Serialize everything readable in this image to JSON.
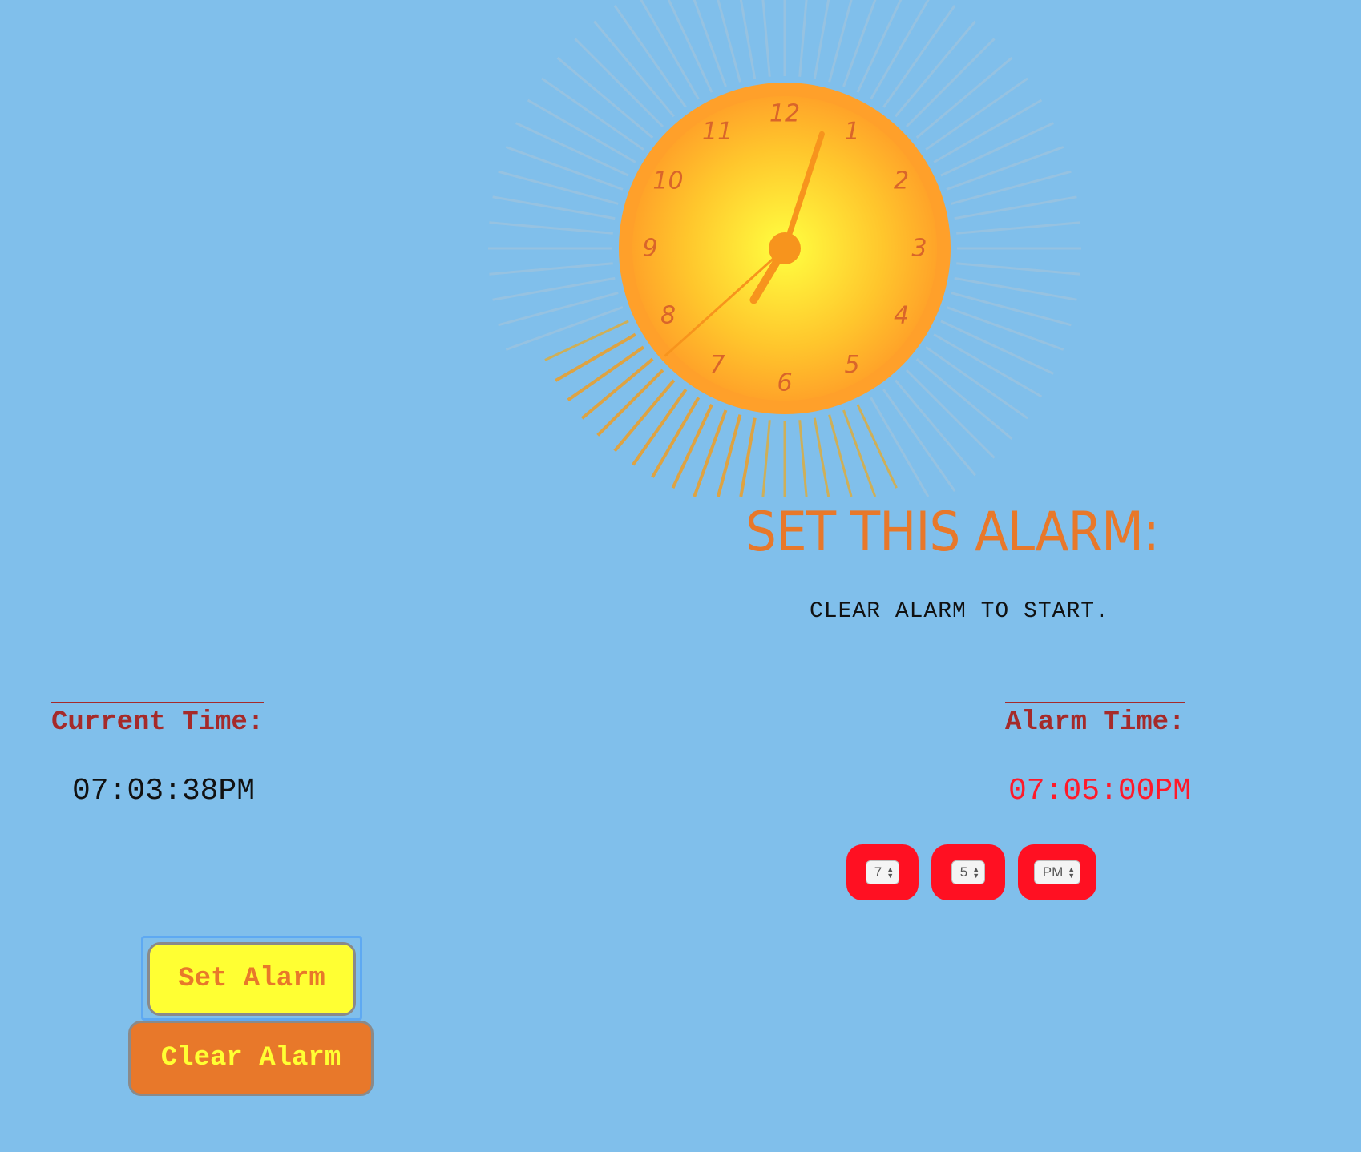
{
  "clock": {
    "numbers": [
      "12",
      "1",
      "2",
      "3",
      "4",
      "5",
      "6",
      "7",
      "8",
      "9",
      "10",
      "11"
    ],
    "displayed_time": "7:03"
  },
  "header": {
    "title": "SET THIS ALARM:",
    "instruction": "CLEAR ALARM TO START."
  },
  "current": {
    "heading": "Current Time:",
    "time": "07:03:38PM"
  },
  "alarm": {
    "heading": "Alarm Time:",
    "time": "07:05:00PM",
    "hour": "7",
    "minute": "5",
    "ampm": "PM"
  },
  "buttons": {
    "set_label": "Set Alarm",
    "clear_label": "Clear Alarm"
  },
  "colors": {
    "background": "#80bfeb",
    "sun_center": "#ffff40",
    "sun_edge": "#ff9a28",
    "accent_orange": "#e8782a",
    "heading_red": "#a52a2a",
    "alarm_red": "#ff1a2a",
    "button_yellow": "#ffff33"
  }
}
